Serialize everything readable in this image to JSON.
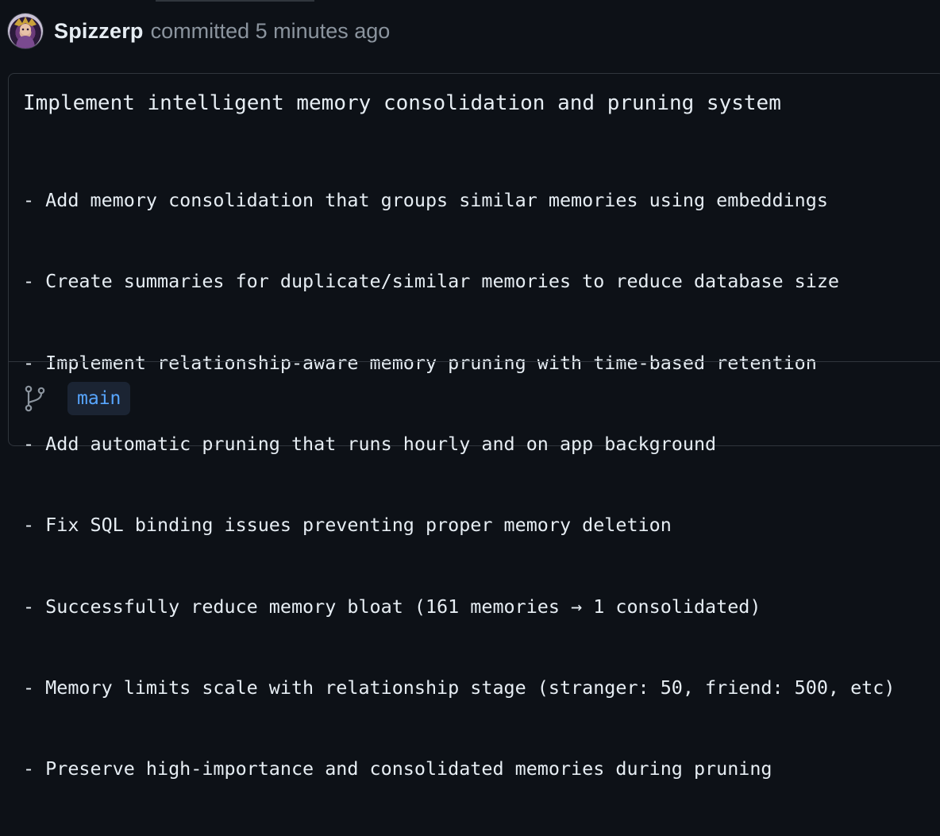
{
  "commit": {
    "author": "Spizzerp",
    "action_text": "committed 5 minutes ago",
    "avatar_icon": "user-avatar",
    "title": "Implement intelligent memory consolidation and pruning system",
    "body_lines": [
      "- Add memory consolidation that groups similar memories using embeddings",
      "- Create summaries for duplicate/similar memories to reduce database size",
      "- Implement relationship-aware memory pruning with time-based retention",
      "- Add automatic pruning that runs hourly and on app background",
      "- Fix SQL binding issues preventing proper memory deletion",
      "- Successfully reduce memory bloat (161 memories → 1 consolidated)",
      "- Memory limits scale with relationship stage (stranger: 50, friend: 500, etc)",
      "- Preserve high-importance and consolidated memories during pruning"
    ],
    "branch_icon": "git-branch-icon",
    "branch": "main"
  },
  "colors": {
    "background": "#0d1117",
    "border": "#30363d",
    "text": "#e6edf3",
    "muted": "#8b949e",
    "branch_text": "#58a6ff",
    "branch_bg": "#1b2433"
  }
}
